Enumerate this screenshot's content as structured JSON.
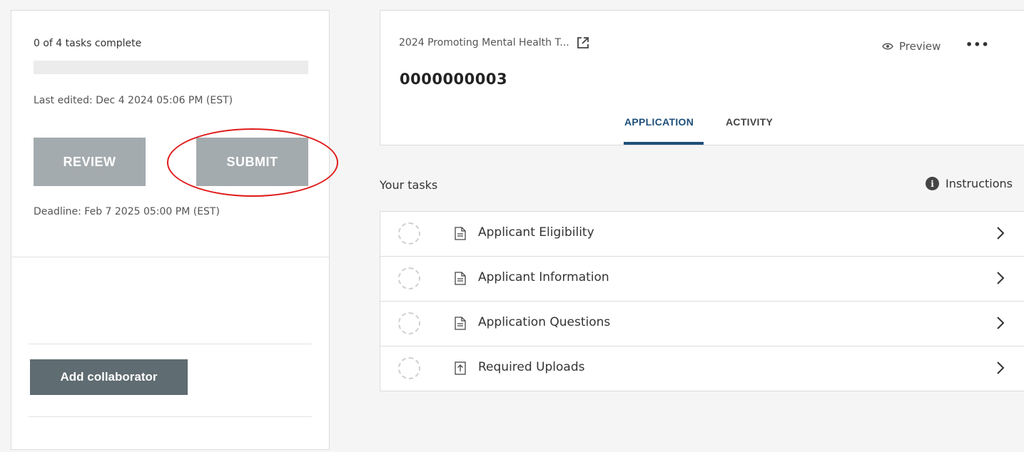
{
  "left_panel": {
    "tasks_complete": "0 of 4 tasks complete",
    "progress_fraction": 0,
    "last_edited": "Last edited: Dec 4 2024 05:06 PM (EST)",
    "review_label": "REVIEW",
    "submit_label": "SUBMIT",
    "deadline": "Deadline: Feb 7 2025 05:00 PM (EST)",
    "add_collaborator_label": "Add collaborator"
  },
  "header": {
    "program_title": "2024 Promoting Mental Health T...",
    "application_number": "0000000003",
    "preview_label": "Preview",
    "more_label": "•••",
    "tabs": [
      {
        "label": "APPLICATION",
        "active": true
      },
      {
        "label": "ACTIVITY",
        "active": false
      }
    ]
  },
  "tasks": {
    "heading": "Your tasks",
    "instructions_label": "Instructions",
    "items": [
      {
        "label": "Applicant Eligibility",
        "icon": "document-icon"
      },
      {
        "label": "Applicant Information",
        "icon": "document-icon"
      },
      {
        "label": "Application Questions",
        "icon": "document-icon"
      },
      {
        "label": "Required Uploads",
        "icon": "upload-icon"
      }
    ]
  },
  "colors": {
    "accent": "#1e4f7a",
    "annotation": "#e01b1b",
    "disabled_button": "#a4abae",
    "collab_button": "#5f6c71"
  }
}
